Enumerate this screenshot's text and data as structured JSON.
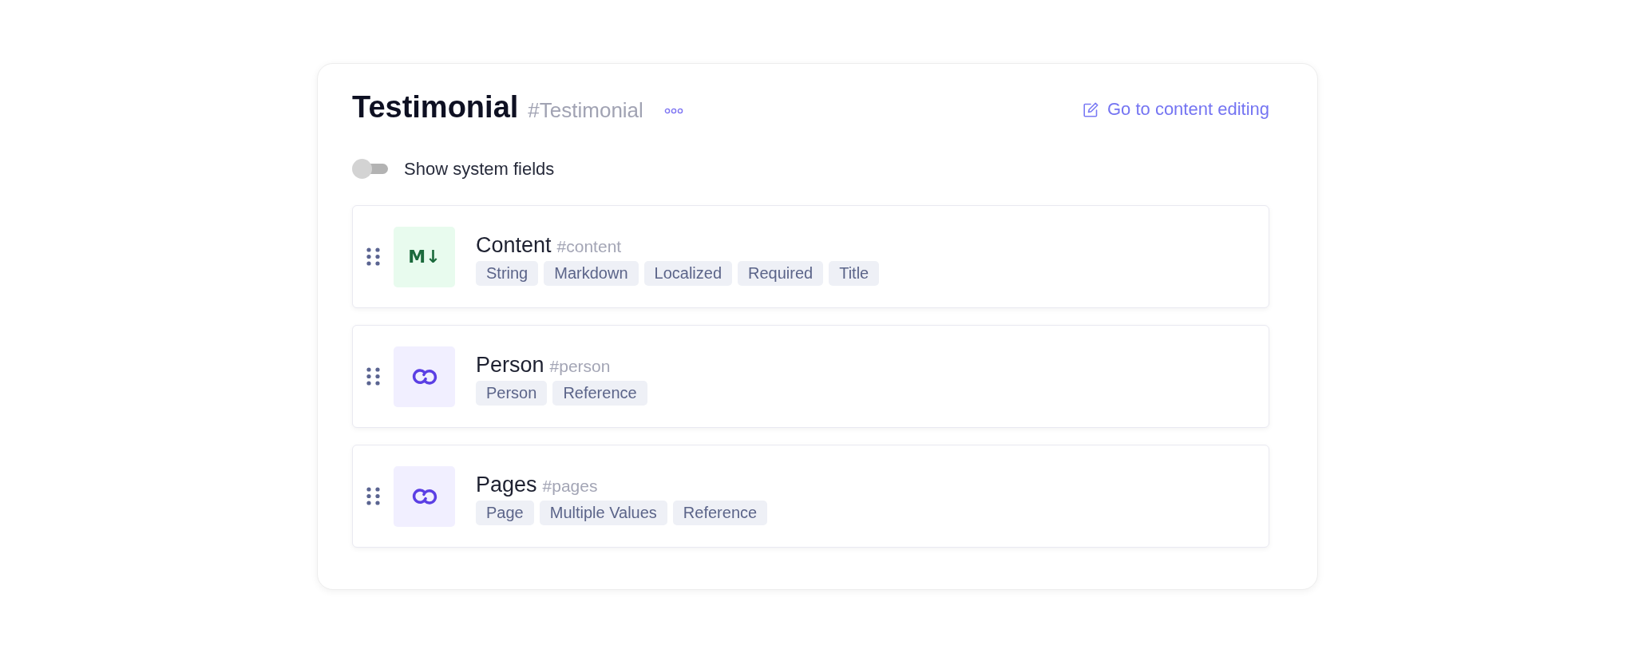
{
  "header": {
    "title": "Testimonial",
    "handle": "#Testimonial",
    "link": "Go to content editing"
  },
  "system_fields_toggle": {
    "label": "Show system fields",
    "on": false
  },
  "fields": [
    {
      "kind": "markdown",
      "icon_text": "M↓",
      "name": "Content",
      "handle": "#content",
      "tags": [
        "String",
        "Markdown",
        "Localized",
        "Required",
        "Title"
      ]
    },
    {
      "kind": "reference",
      "name": "Person",
      "handle": "#person",
      "tags": [
        "Person",
        "Reference"
      ]
    },
    {
      "kind": "reference",
      "name": "Pages",
      "handle": "#pages",
      "tags": [
        "Page",
        "Multiple Values",
        "Reference"
      ]
    }
  ]
}
